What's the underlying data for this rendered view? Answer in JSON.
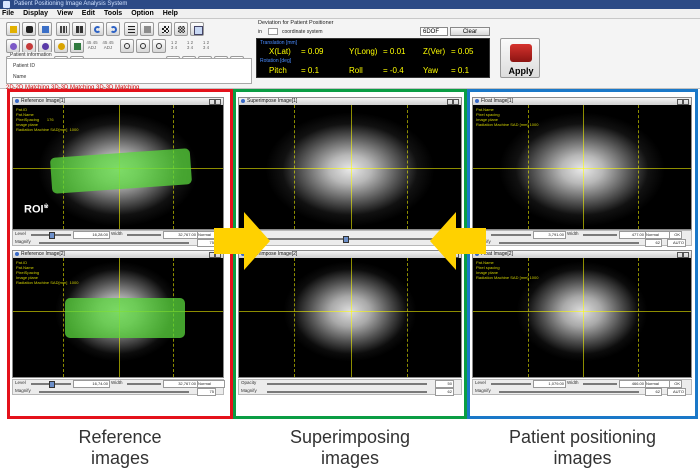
{
  "window": {
    "title": "Patient Positioning Image Analysis System"
  },
  "menu": [
    "File",
    "Display",
    "View",
    "Edit",
    "Tools",
    "Option",
    "Help"
  ],
  "patient_info": {
    "heading": "Patient information",
    "id_label": "Patient ID",
    "name_label": "Name"
  },
  "deviation": {
    "heading": "Deviation for Patient Positioner",
    "in_label": "in",
    "coord_system": "coordinate system",
    "dof_select": "6DOF",
    "clear_label": "Clear",
    "translation_label": "Translation [mm]",
    "rotation_label": "Rotation [deg]",
    "x_label": "X(Lat)",
    "x_value": "= 0.09",
    "y_label": "Y(Long)",
    "y_value": "= 0.01",
    "z_label": "Z(Ver)",
    "z_value": "= 0.05",
    "pitch_label": "Pitch",
    "pitch_value": "= 0.1",
    "roll_label": "Roll",
    "roll_value": "= -0.4",
    "yaw_label": "Yaw",
    "yaw_value": "= 0.1"
  },
  "apply_label": "Apply",
  "status_strip": "2D-2D Matching   3D-3D Matching   3D-3D Matching",
  "panels": {
    "ref1": {
      "title": "Reference Image[1]",
      "info": "Pat.ID     \nPat.Name   \nPixelSpacing       176\nImage plane        \nRadiation Machine SAD[mm]  1000",
      "level": "16,28.00",
      "width": "32,767.00",
      "magnify": "75"
    },
    "ref2": {
      "title": "Reference Image[2]",
      "info": "Pat.ID     \nPat.Name   \nPixelSpacing       \nImage plane        \nRadiation Machine SAD[mm]  1000",
      "level": "16,74.00",
      "width": "32,767.00",
      "magnify": "75"
    },
    "sup1": {
      "title": "Superimpose Image[1]"
    },
    "sup2": {
      "title": "Superimpose Image[2]",
      "opacity": "50",
      "magnify": "62"
    },
    "fl1": {
      "title": "Float Image[1]",
      "info": "Pat.Name  \nPixel spacing   \nImage plane    \nRadiation Machine SAD [mm] 1000",
      "level": "3,791.00",
      "width": "477.00",
      "magnify": "62"
    },
    "fl2": {
      "title": "Float Image[2]",
      "info": "Pat.Name  \nPixel spacing  \nImage plane    \nRadiation Machine SAD [mm] 1000",
      "level": "1,079.00",
      "width": "466.00",
      "magnify": "62"
    }
  },
  "controls": {
    "level_label": "Level",
    "width_label": "Width",
    "magnify_label": "Magnify",
    "normal": "Normal",
    "opacity_label": "Opacity",
    "ok": "OK",
    "auto": "AUTO"
  },
  "roi_label": "ROI",
  "roi_superscript": "※",
  "captions": {
    "reference": [
      "Reference",
      "images"
    ],
    "superimposing": [
      "Superimposing",
      "images"
    ],
    "positioning": [
      "Patient positioning",
      "images"
    ]
  },
  "colors": {
    "reference_frame": "#e4121b",
    "superimposing_frame": "#0a9d44",
    "positioning_frame": "#1a78c8",
    "arrow": "#ffd100",
    "roi": "#5ad73c",
    "readout": "#ffff00"
  }
}
